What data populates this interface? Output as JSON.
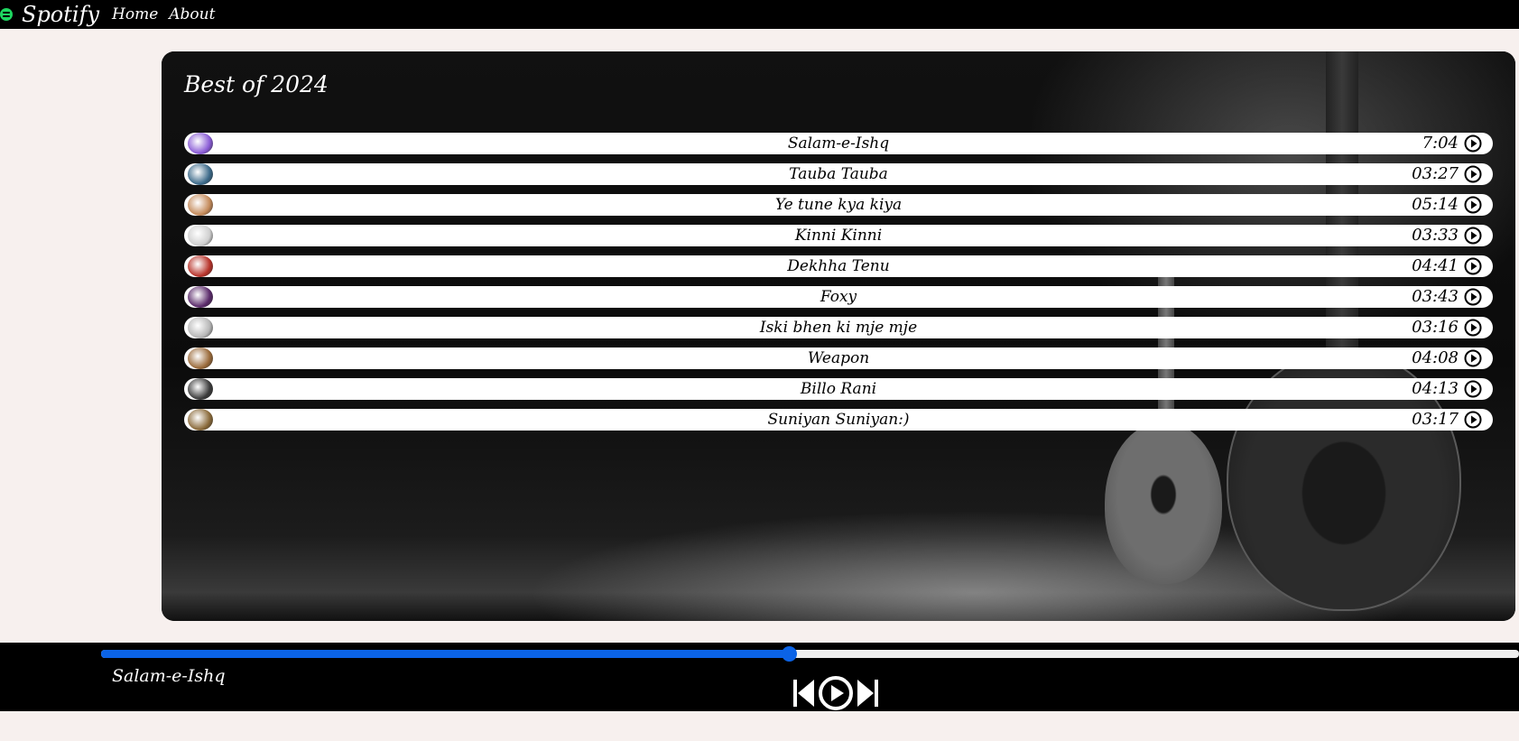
{
  "nav": {
    "brand": "Spotify",
    "links": [
      "Home",
      "About"
    ],
    "logo_icon": "spotify-logo-icon",
    "logo_color": "#1ed760"
  },
  "playlist": {
    "title": "Best of 2024",
    "songs": [
      {
        "name": "Salam-e-Ishq",
        "duration": "7:04",
        "thumb_color": "#8a5cd6"
      },
      {
        "name": "Tauba Tauba",
        "duration": "03:27",
        "thumb_color": "#3c6a8a"
      },
      {
        "name": "Ye tune kya kiya",
        "duration": "05:14",
        "thumb_color": "#c48a5a"
      },
      {
        "name": "Kinni Kinni",
        "duration": "03:33",
        "thumb_color": "#cfcfcf"
      },
      {
        "name": "Dekhha Tenu",
        "duration": "04:41",
        "thumb_color": "#b8332a"
      },
      {
        "name": "Foxy",
        "duration": "03:43",
        "thumb_color": "#5a2a6a"
      },
      {
        "name": "Iski bhen ki mje mje",
        "duration": "03:16",
        "thumb_color": "#b7b7b7"
      },
      {
        "name": "Weapon",
        "duration": "04:08",
        "thumb_color": "#9a6a3a"
      },
      {
        "name": "Billo Rani",
        "duration": "04:13",
        "thumb_color": "#3a3a3a"
      },
      {
        "name": "Suniyan Suniyan:)",
        "duration": "03:17",
        "thumb_color": "#8a6a3a"
      }
    ]
  },
  "player": {
    "now_playing": "Salam-e-Ishq",
    "progress_fraction": 0.485,
    "progress_color": "#0b63e6",
    "controls": [
      "previous-icon",
      "play-circle-icon",
      "next-icon"
    ]
  }
}
